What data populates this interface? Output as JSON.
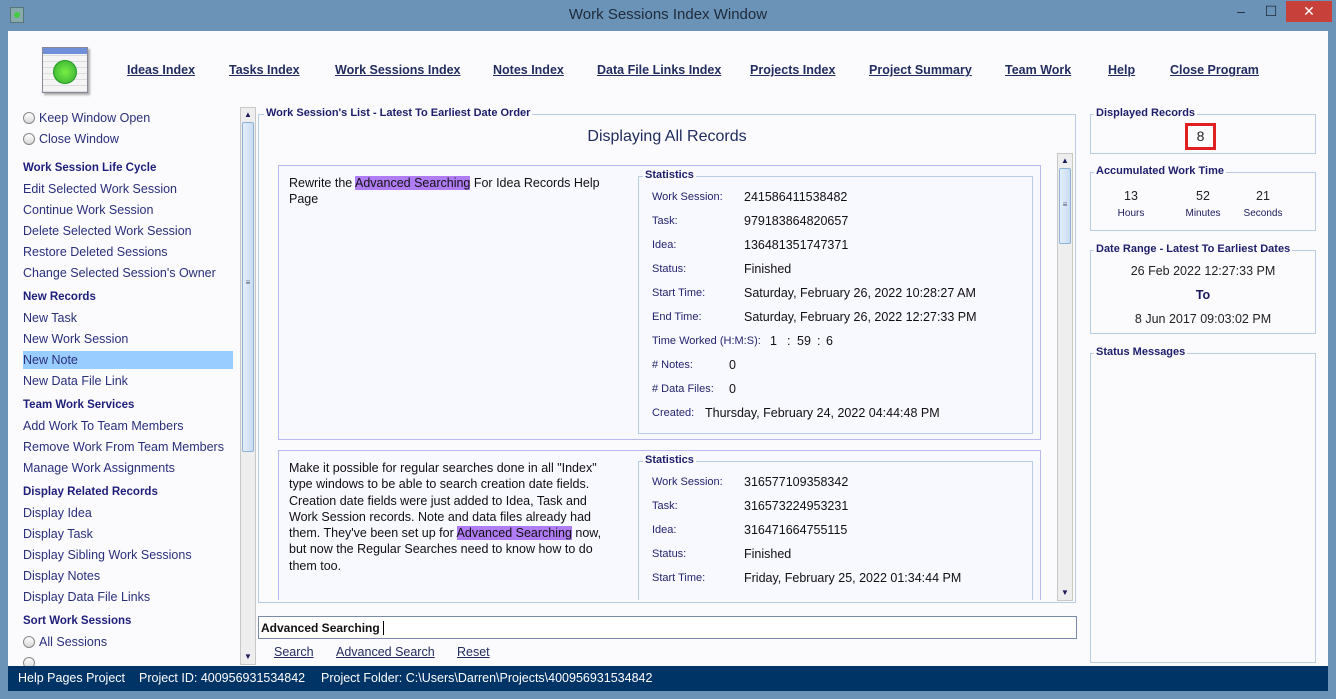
{
  "window": {
    "title": "Work Sessions Index Window",
    "minimize": "–",
    "maximize": "☐",
    "close": "✕"
  },
  "nav": [
    "Ideas Index",
    "Tasks Index",
    "Work Sessions Index",
    "Notes Index",
    "Data File Links Index",
    "Projects Index",
    "Project Summary",
    "Team Work",
    "Help",
    "Close Program"
  ],
  "left": {
    "radios": [
      "Keep Window Open",
      "Close Window"
    ],
    "sections": [
      {
        "title": "Work Session Life Cycle",
        "items": [
          "Edit Selected Work Session",
          "Continue Work Session",
          "Delete Selected Work Session",
          "Restore Deleted Sessions",
          "Change Selected Session's Owner"
        ]
      },
      {
        "title": "New Records",
        "items": [
          "New Task",
          "New Work Session",
          "New Note",
          "New Data File Link"
        ]
      },
      {
        "title": "Team Work Services",
        "items": [
          "Add Work To Team Members",
          "Remove Work From Team Members",
          "Manage Work Assignments"
        ]
      },
      {
        "title": "Display Related Records",
        "items": [
          "Display Idea",
          "Display Task",
          "Display Sibling Work Sessions",
          "Display Notes",
          "Display Data File Links"
        ]
      },
      {
        "title": "Sort Work Sessions",
        "items": [
          "All Sessions"
        ]
      }
    ],
    "selected": "New Note"
  },
  "main": {
    "group_title": "Work Session's List - Latest To Earliest Date Order",
    "heading": "Displaying All Records",
    "highlight": "Advanced Searching",
    "stats_title": "Statistics",
    "labels": {
      "ws": "Work Session:",
      "task": "Task:",
      "idea": "Idea:",
      "status": "Status:",
      "start": "Start Time:",
      "end": "End Time:",
      "worked": "Time Worked (H:M:S):",
      "notes": "# Notes:",
      "files": "# Data Files:",
      "created": "Created:"
    },
    "records": [
      {
        "pre": "Rewrite the ",
        "post": " For Idea Records Help Page",
        "ws": "241586411538482",
        "task": "979183864820657",
        "idea": "136481351747371",
        "status": "Finished",
        "start": "Saturday, February 26, 2022   10:28:27 AM",
        "end": "Saturday, February 26, 2022   12:27:33 PM",
        "h": "1",
        "m": "59",
        "s": "6",
        "notes": "0",
        "files": "0",
        "created": "Thursday, February 24, 2022   04:44:48 PM"
      },
      {
        "pre": "Make it possible for regular searches done in all \"Index\" type windows to be able to search creation date fields. Creation date fields were just added to Idea, Task and Work Session records. Note and data files already had them. They've been set up for ",
        "post": " now, but now the Regular Searches need to know how to do them too.",
        "ws": "316577109358342",
        "task": "316573224953231",
        "idea": "316471664755115",
        "status": "Finished",
        "start": "Friday, February 25, 2022   01:34:44 PM"
      }
    ],
    "search_value": "Advanced Searching",
    "buttons": [
      "Search",
      "Advanced Search",
      "Reset"
    ]
  },
  "right": {
    "displayed_title": "Displayed Records",
    "displayed": "8",
    "acc_title": "Accumulated Work Time",
    "hours": "13",
    "hours_l": "Hours",
    "minutes": "52",
    "minutes_l": "Minutes",
    "seconds": "21",
    "seconds_l": "Seconds",
    "range_title": "Date Range - Latest To Earliest Dates",
    "latest": "26 Feb 2022  12:27:33 PM",
    "to": "To",
    "earliest": "8 Jun 2017  09:03:02 PM",
    "status_title": "Status Messages"
  },
  "statusbar": {
    "project": "Help Pages Project",
    "id": "Project ID:  400956931534842",
    "folder": "Project Folder: C:\\Users\\Darren\\Projects\\400956931534842"
  },
  "colors": {
    "titlebar": "#6b93b8",
    "statusbar": "#003366",
    "highlight": "#b07cf5",
    "selected": "#99ccff",
    "count_box": "#e02020"
  }
}
